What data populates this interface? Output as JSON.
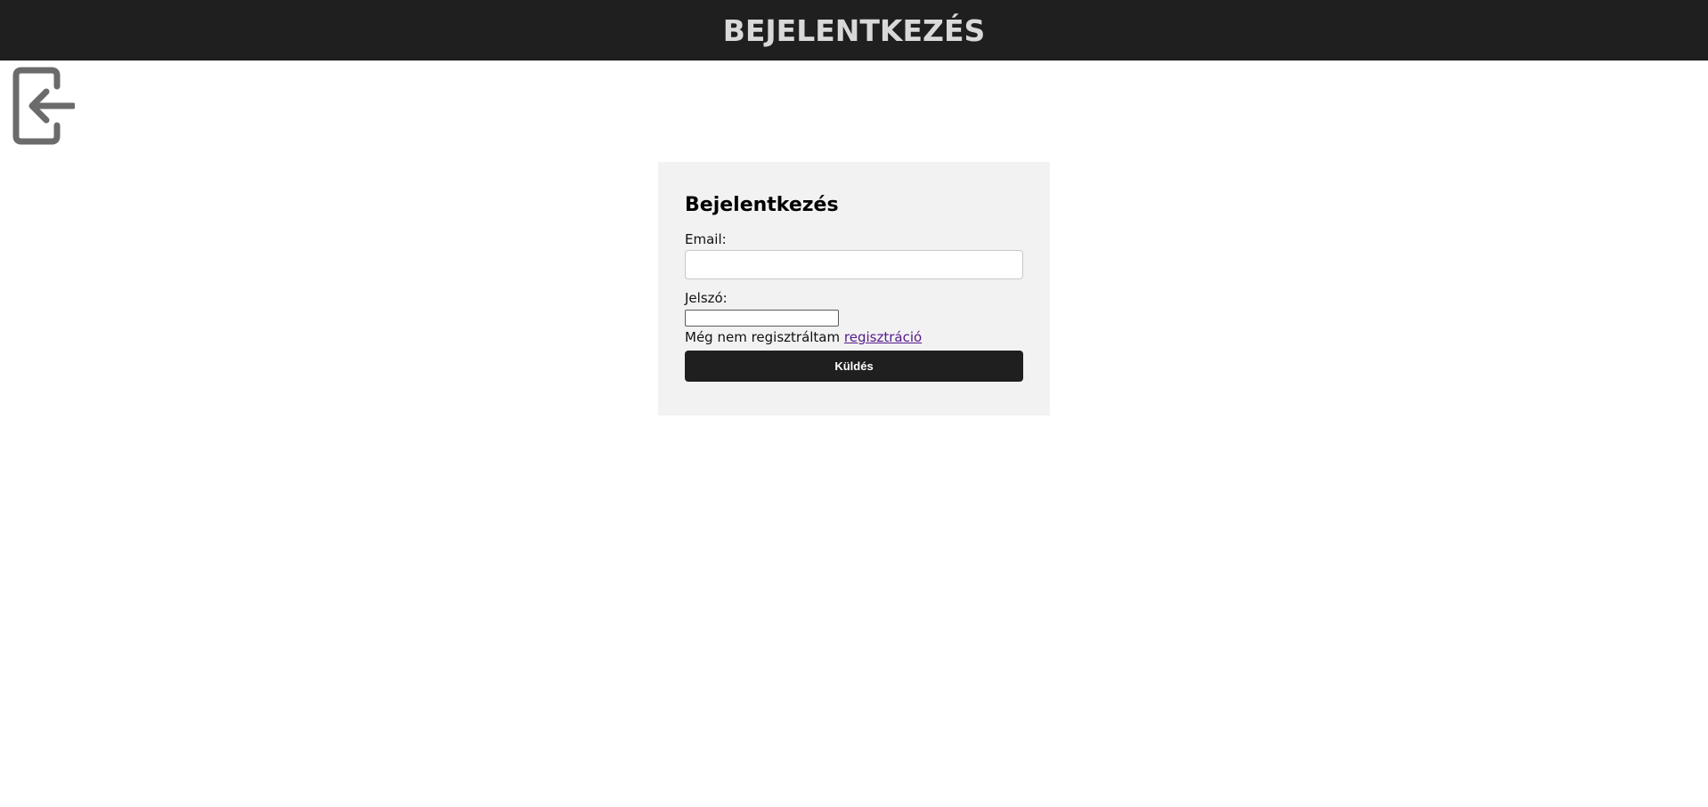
{
  "header": {
    "title": "BEJELENTKEZÉS"
  },
  "back_button": {
    "icon": "logout-arrow-left-icon",
    "color": "#6b6b6b"
  },
  "login_form": {
    "title": "Bejelentkezés",
    "email_label": "Email:",
    "email_value": "",
    "password_label": "Jelszó:",
    "password_value": "",
    "register_text": "Még nem regisztráltam",
    "register_link": "regisztráció",
    "submit_label": "Küldés"
  },
  "colors": {
    "header_bg": "#1f1f1f",
    "header_text": "#d9d9d9",
    "card_bg": "#f2f2f2",
    "button_bg": "#1f1f1f",
    "link": "#551a8b"
  }
}
